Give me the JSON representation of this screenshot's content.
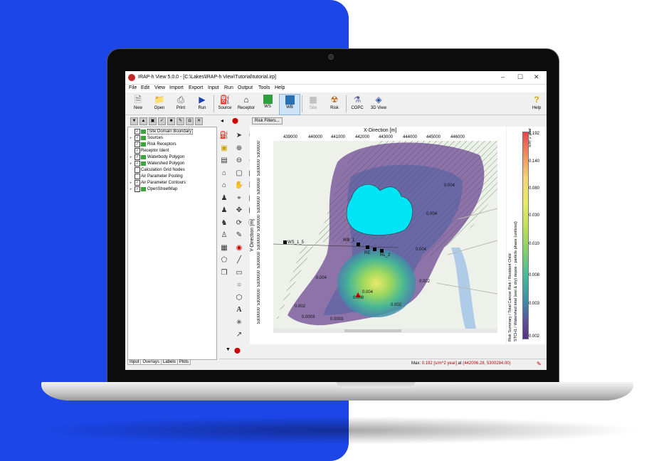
{
  "window": {
    "title": "IRAP-h View 5.0.0 - [C:\\Lakes\\IRAP-h View\\Tutorial\\tutorial.irp]"
  },
  "menu": [
    "File",
    "Edit",
    "View",
    "Import",
    "Export",
    "Input",
    "Run",
    "Output",
    "Tools",
    "Help"
  ],
  "toolbar": {
    "new": "New",
    "open": "Open",
    "print": "Print",
    "run": "Run",
    "source": "Source",
    "receptor": "Receptor",
    "ws": "WS",
    "wb": "WB",
    "site": "Site",
    "risk": "Risk",
    "copc": "COPC",
    "view3d": "3D View",
    "help": "Help"
  },
  "tree": {
    "items": [
      {
        "label": "Site Domain Boundary",
        "checked": true,
        "expand": "",
        "selected": true
      },
      {
        "label": "Sources",
        "checked": true,
        "expand": "+"
      },
      {
        "label": "Risk Receptors",
        "checked": true,
        "expand": ""
      },
      {
        "label": "Receptor Ident",
        "checked": true,
        "expand": ""
      },
      {
        "label": "Waterbody Polygon",
        "checked": true,
        "expand": "+"
      },
      {
        "label": "Watershed Polygon",
        "checked": true,
        "expand": "+"
      },
      {
        "label": "Calculation Grid Nodes",
        "checked": false,
        "expand": ""
      },
      {
        "label": "Air Parameter Posting",
        "checked": false,
        "expand": ""
      },
      {
        "label": "Air Parameter Contours",
        "checked": true,
        "expand": "+"
      },
      {
        "label": "OpenStreetMap",
        "checked": true,
        "expand": "+"
      }
    ]
  },
  "tabs": [
    "Input",
    "Overlays",
    "Labels",
    "Plots"
  ],
  "map": {
    "risk_filters": "Risk Filters...",
    "x_title": "X-Direction [m]",
    "y_title": "Y-Direction [m]",
    "x_ticks": [
      "439000",
      "440000",
      "441000",
      "442000",
      "443000",
      "444000",
      "445000",
      "446000"
    ],
    "y_ticks": [
      "5300000",
      "5300000",
      "5300000",
      "5300000",
      "5300000",
      "5300000",
      "5300000",
      "5300000",
      "5300000",
      "5300000"
    ],
    "labels": [
      "WS_1_5",
      "WB_1",
      "RE",
      "RL_2",
      "0.004",
      "0.008",
      "0.002",
      "0.004",
      "0.0003",
      "0.0003",
      "0.004",
      "0.004",
      "0.002",
      "0.004",
      "0.002"
    ],
    "colors": {
      "waterbody": "#00e5f5",
      "contour_low": "#5b2f86",
      "contour_high": "#eae96a"
    }
  },
  "legend": {
    "title_line1": "STCH1 / Watershed total (wet & dry) depos - particle phase (unitized)",
    "title_line2": "Risk Summary / Total Cancer Risk / Resident Child",
    "unit": "s/m^2 year",
    "ticks": [
      "0.192",
      "0.140",
      "0.080",
      "0.030",
      "0.010",
      "0.008",
      "0.003",
      "0.002"
    ]
  },
  "status": {
    "max_label": "Max:",
    "max_value": "0.192 [s/m^2 year]",
    "at_label": "at",
    "coords": "(442006.28, 5300284.00)"
  }
}
